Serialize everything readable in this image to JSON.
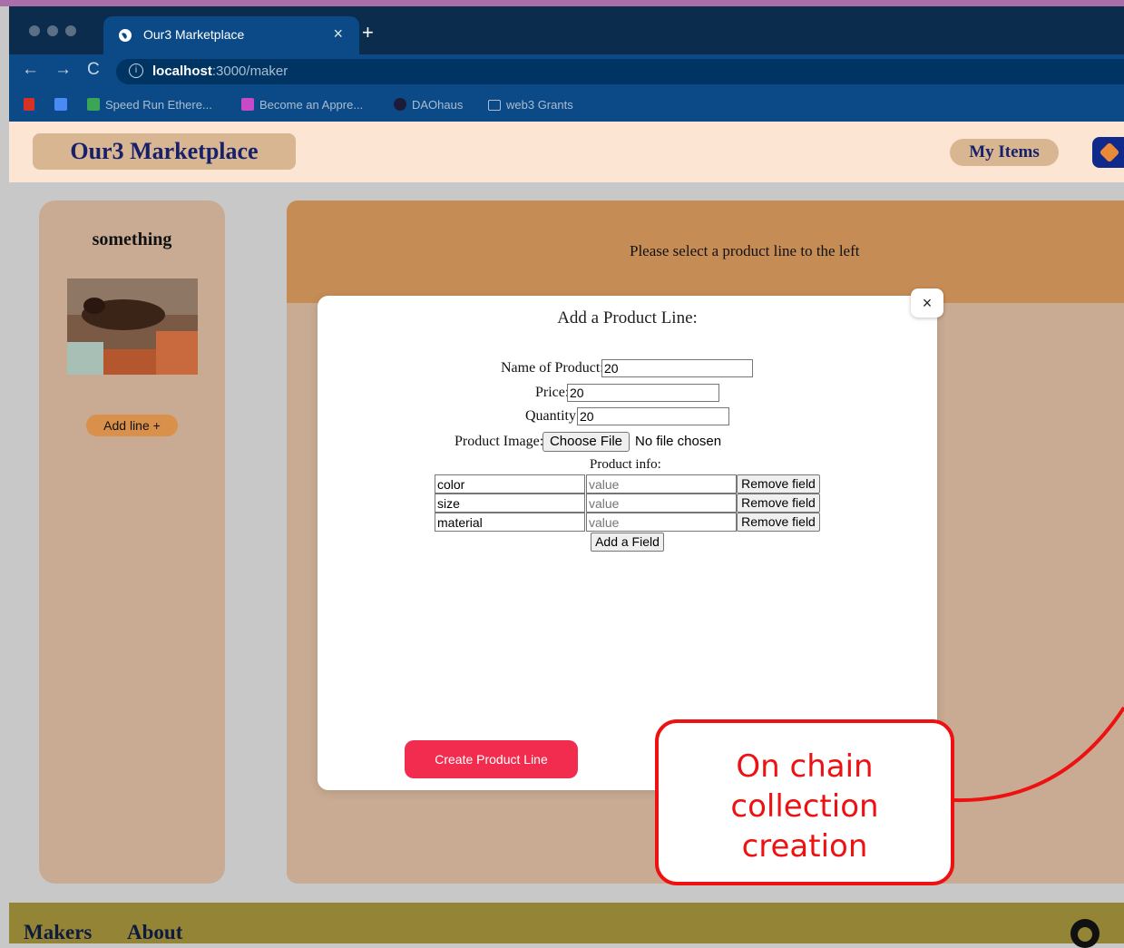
{
  "browser": {
    "tab_title": "Our3 Marketplace",
    "url_host": "localhost",
    "url_path": ":3000/maker",
    "bookmarks": [
      {
        "label": "",
        "icon": "gmail-icon",
        "color": "#d93025"
      },
      {
        "label": "",
        "icon": "calendar-icon",
        "color": "#4a8af4"
      },
      {
        "label": "Speed Run Ethere...",
        "icon": "speedrun-icon",
        "color": "#3aa655"
      },
      {
        "label": "Become an Appre...",
        "icon": "crossed-swords-icon",
        "color": "#c94ac9"
      },
      {
        "label": "DAOhaus",
        "icon": "daohaus-icon",
        "color": "#1c1c3a"
      },
      {
        "label": "web3 Grants",
        "icon": "folder-icon",
        "color": "#a9bdd3"
      }
    ]
  },
  "header": {
    "logo": "Our3 Marketplace",
    "my_items": "My Items"
  },
  "sidebar": {
    "title": "something",
    "add_line": "Add line +"
  },
  "main": {
    "banner_text": "Please select a product line to the left"
  },
  "modal": {
    "close": "×",
    "title": "Add a Product Line:",
    "name_label": "Name of Product:",
    "name_value": "20",
    "price_label": "Price:",
    "price_value": "20",
    "quantity_label": "Quantity:",
    "quantity_value": "20",
    "image_label": "Product Image:",
    "choose_file": "Choose File",
    "no_file": "No file chosen",
    "info_label": "Product info:",
    "fields": [
      {
        "key": "color",
        "value_placeholder": "value",
        "remove": "Remove field"
      },
      {
        "key": "size",
        "value_placeholder": "value",
        "remove": "Remove field"
      },
      {
        "key": "material",
        "value_placeholder": "value",
        "remove": "Remove field"
      }
    ],
    "add_field": "Add a Field",
    "create": "Create Product Line"
  },
  "callout": {
    "line1": "On chain",
    "line2": "collection",
    "line3": "creation",
    "color": "#ee1111"
  },
  "footer": {
    "makers": "Makers",
    "about": "About"
  }
}
